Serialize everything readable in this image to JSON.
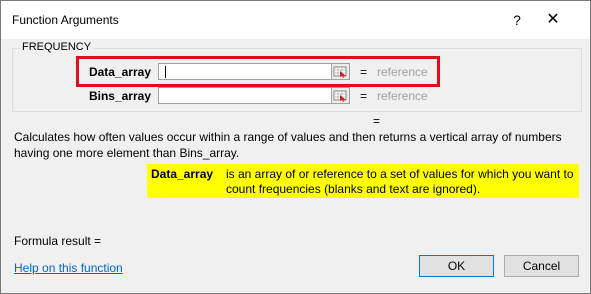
{
  "window": {
    "title": "Function Arguments",
    "help_glyph": "?",
    "close_glyph": "✕"
  },
  "function": {
    "name": "FREQUENCY",
    "args": [
      {
        "name": "Data_array",
        "value": "",
        "equals": "=",
        "result": "reference"
      },
      {
        "name": "Bins_array",
        "value": "",
        "equals": "=",
        "result": "reference"
      }
    ],
    "result_equals": "=",
    "description": "Calculates how often values occur within a range of values and then returns a vertical array of numbers having one more element than Bins_array.",
    "arg_help": {
      "name": "Data_array",
      "text": "is an array of or reference to a set of values for which you want to count frequencies (blanks and text are ignored)."
    }
  },
  "footer": {
    "formula_result": "Formula result =",
    "help_link": "Help on this function",
    "ok": "OK",
    "cancel": "Cancel"
  },
  "colors": {
    "highlight_border": "#e0101a",
    "help_bg": "#ffff00",
    "link": "#0066cc",
    "default_button_border": "#0078d7"
  },
  "icons": [
    "range-select-icon",
    "help-icon",
    "close-icon"
  ]
}
